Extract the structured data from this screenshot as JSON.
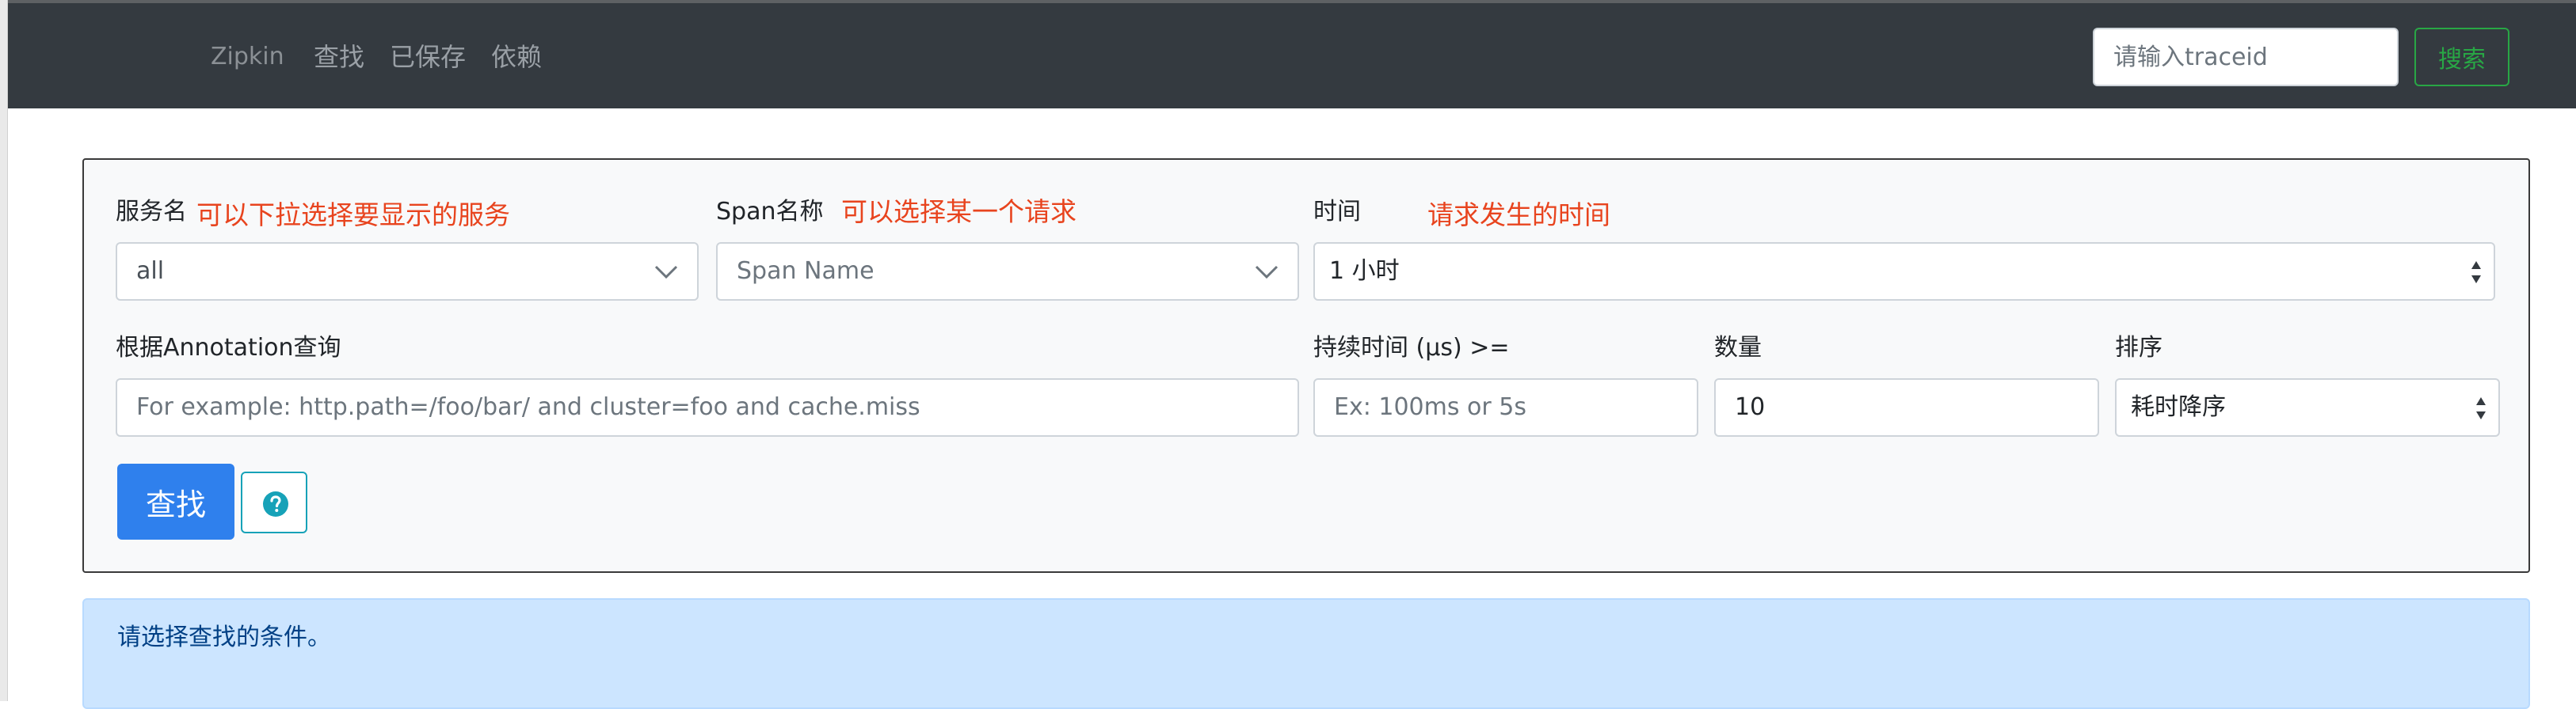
{
  "navbar": {
    "brand": "Zipkin",
    "links": [
      "查找",
      "已保存",
      "依赖"
    ],
    "search_placeholder": "请输入traceid",
    "search_button": "搜索"
  },
  "form": {
    "service": {
      "label": "服务名",
      "note": "可以下拉选择要显示的服务",
      "value": "all"
    },
    "span": {
      "label": "Span名称",
      "note": "可以选择某一个请求",
      "value": "Span Name"
    },
    "time": {
      "label": "时间",
      "note": "请求发生的时间",
      "value": "1 小时"
    },
    "annotation": {
      "label": "根据Annotation查询",
      "placeholder": "For example: http.path=/foo/bar/ and cluster=foo and cache.miss"
    },
    "duration": {
      "label": "持续时间 (μs) >=",
      "placeholder": "Ex: 100ms or 5s"
    },
    "limit": {
      "label": "数量",
      "value": "10"
    },
    "sort": {
      "label": "排序",
      "value": "耗时降序"
    },
    "query_button": "查找",
    "help_icon": "question-circle-icon"
  },
  "alert": {
    "text": "请选择查找的条件。"
  },
  "colors": {
    "navbar_bg": "#343a40",
    "accent_blue": "#2f80ed",
    "annotation_red": "#e8441e",
    "search_green": "#28a745",
    "help_teal": "#17a2b8",
    "alert_bg": "#cce5ff"
  }
}
